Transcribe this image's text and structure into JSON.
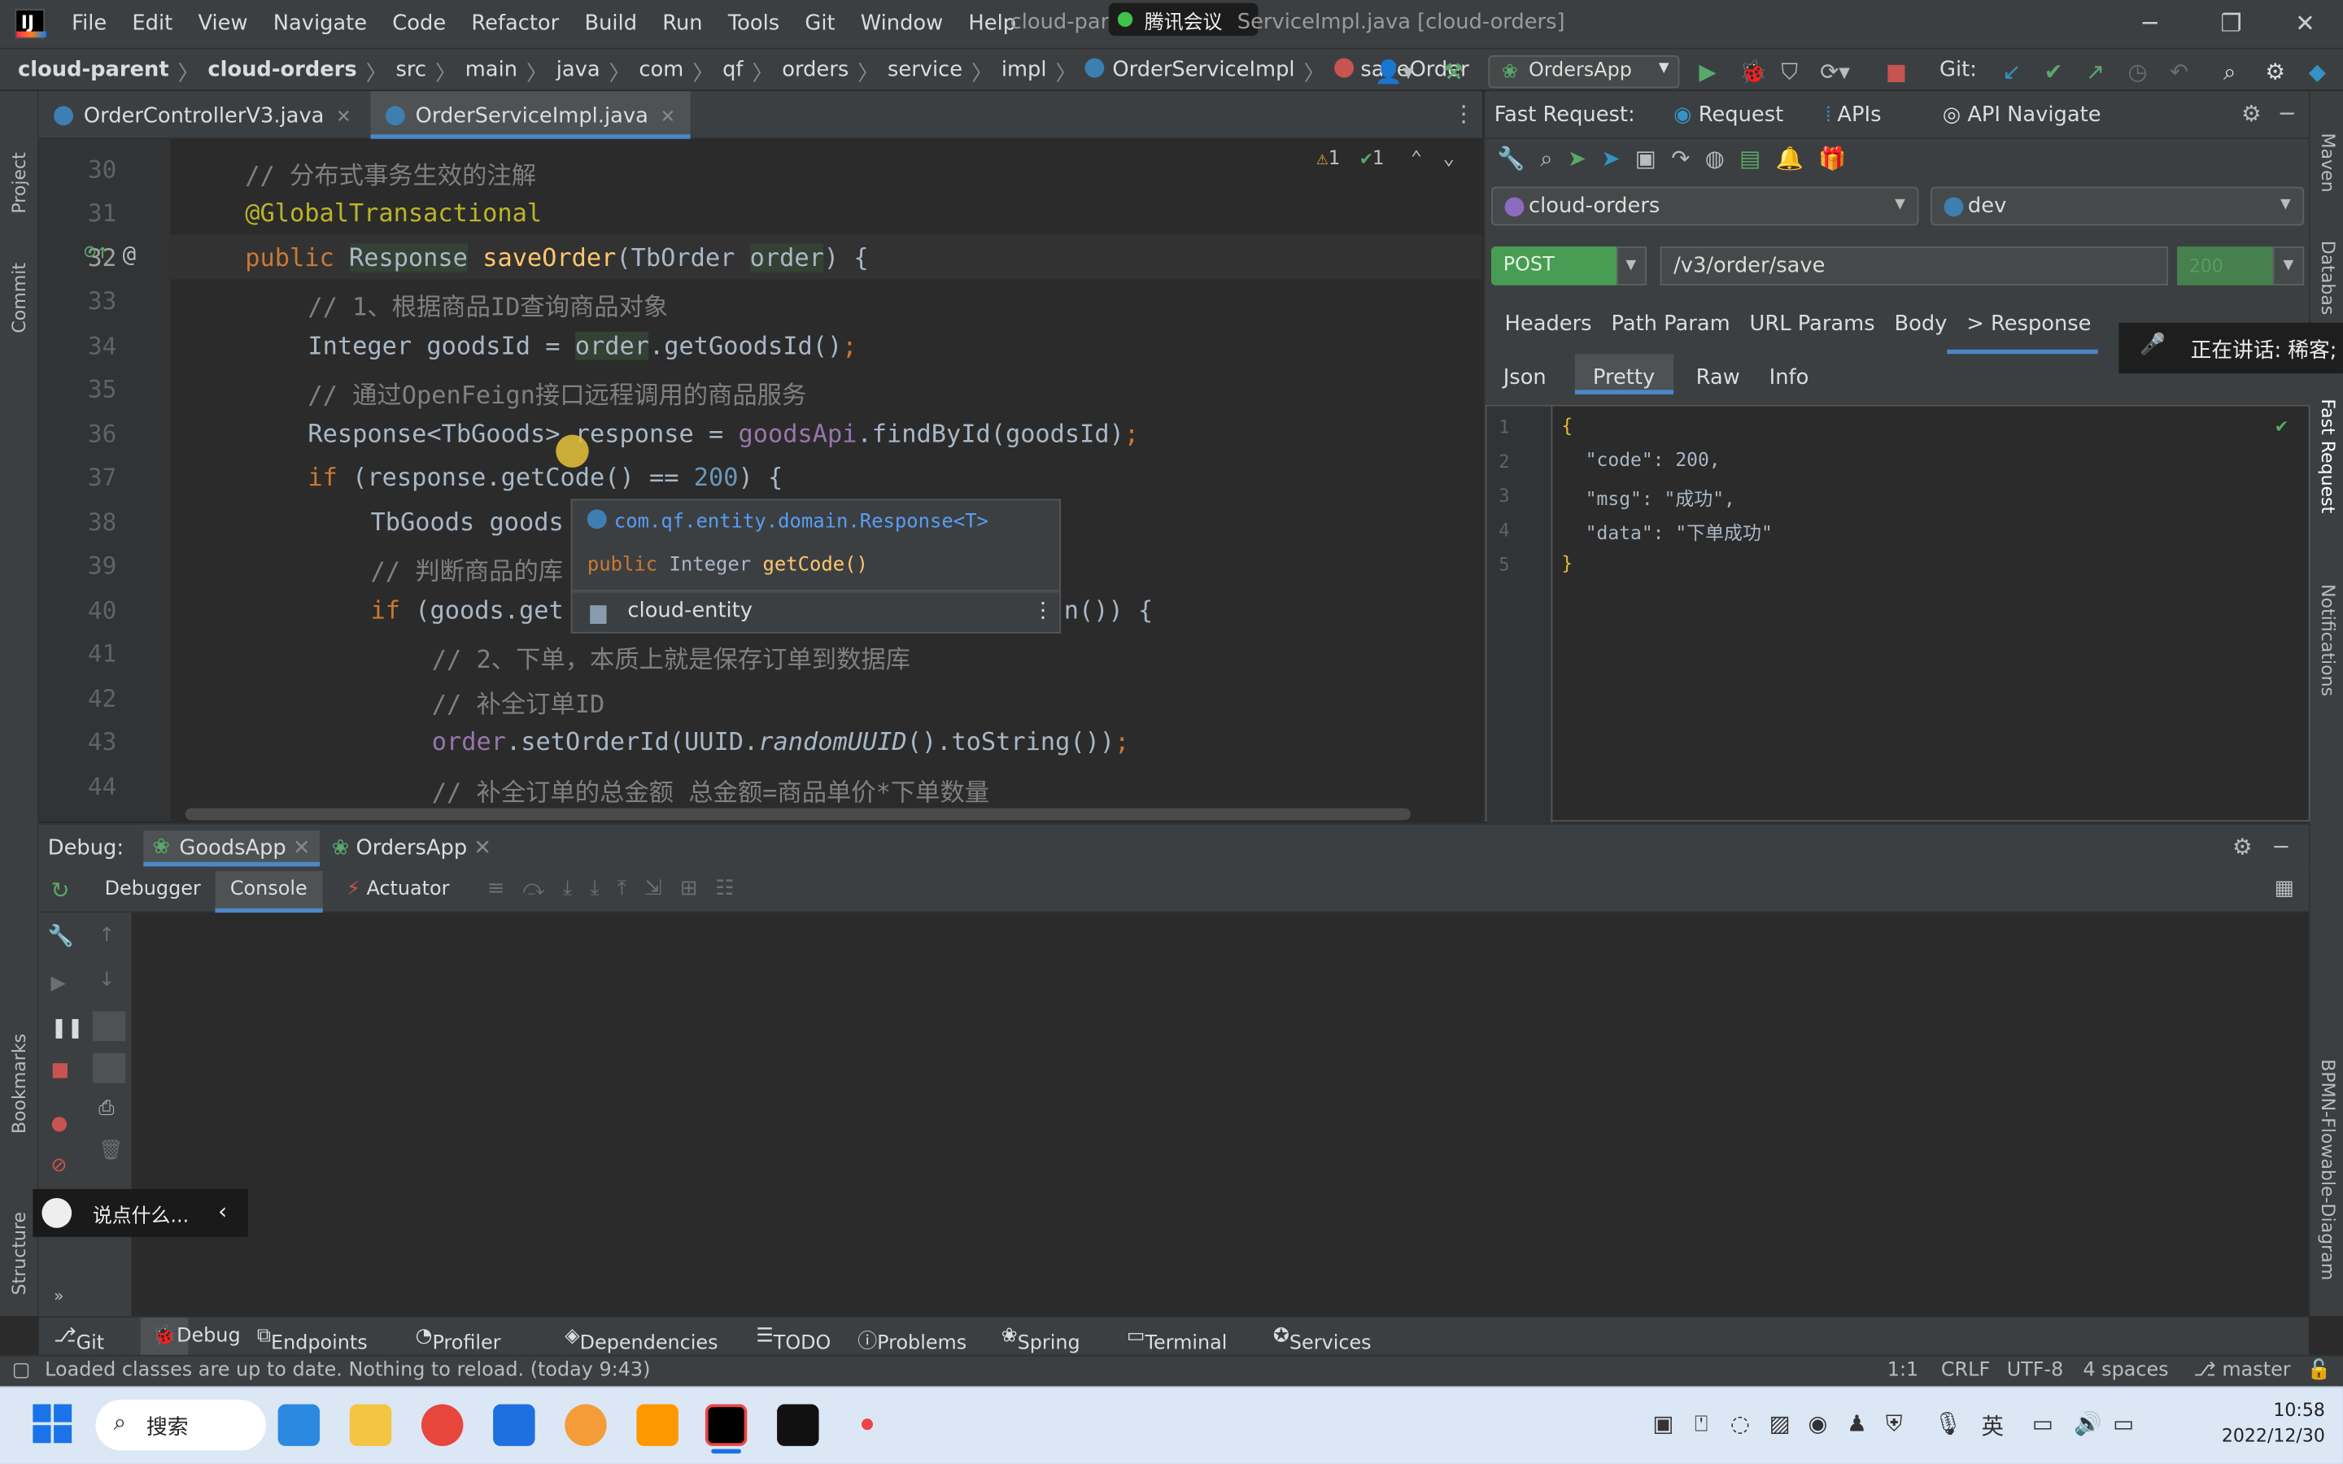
{
  "window": {
    "title": "cloud-parent - OrderServiceImpl.java [cloud-orders]",
    "title_visible": "cloud-par",
    "title_right": "ServiceImpl.java [cloud-orders]",
    "meeting_label": "腾讯会议"
  },
  "menu": [
    "File",
    "Edit",
    "View",
    "Navigate",
    "Code",
    "Refactor",
    "Build",
    "Run",
    "Tools",
    "Git",
    "Window",
    "Help"
  ],
  "breadcrumb": [
    "cloud-parent",
    "cloud-orders",
    "src",
    "main",
    "java",
    "com",
    "qf",
    "orders",
    "service",
    "impl",
    "OrderServiceImpl",
    "saveOrder"
  ],
  "run_config": "OrdersApp",
  "git_label": "Git:",
  "left_strip": [
    "Project",
    "Commit",
    "Bookmarks",
    "Structure"
  ],
  "right_strip": [
    "Maven",
    "Database",
    "Fast Request",
    "Notifications",
    "BPMN-Flowable-Diagram"
  ],
  "editor": {
    "tabs": [
      {
        "label": "OrderControllerV3.java",
        "active": false
      },
      {
        "label": "OrderServiceImpl.java",
        "active": true
      }
    ],
    "inspections": {
      "warnings": "1",
      "ok": "1"
    },
    "lines": [
      {
        "n": "30",
        "text": "// 分布式事务生效的注解"
      },
      {
        "n": "31",
        "text": "@GlobalTransactional"
      },
      {
        "n": "32",
        "text": "public Response saveOrder(TbOrder order) {"
      },
      {
        "n": "33",
        "text": "// 1、根据商品ID查询商品对象"
      },
      {
        "n": "34",
        "text": "Integer goodsId = order.getGoodsId();"
      },
      {
        "n": "35",
        "text": "// 通过OpenFeign接口远程调用的商品服务"
      },
      {
        "n": "36",
        "text": "Response<TbGoods> response = goodsApi.findById(goodsId);"
      },
      {
        "n": "37",
        "text": "if (response.getCode() == 200) {"
      },
      {
        "n": "38",
        "text": "TbGoods goods"
      },
      {
        "n": "39",
        "text": "// 判断商品的库"
      },
      {
        "n": "40",
        "text": "if (goods.get"
      },
      {
        "n": "41",
        "text": "// 2、下单，本质上就是保存订单到数据库"
      },
      {
        "n": "42",
        "text": "// 补全订单ID"
      },
      {
        "n": "43",
        "text": "order.setOrderId(UUID.randomUUID().toString());"
      },
      {
        "n": "44",
        "text": "// 补全订单的总金额 总金额=商品单价*下单数量"
      }
    ],
    "line40_tail": "n()) {",
    "popup": {
      "class": "com.qf.entity.domain.Response<T>",
      "signature": "public Integer getCode()",
      "module": "cloud-entity"
    }
  },
  "fast_request": {
    "title": "Fast Request:",
    "tabs": [
      "Request",
      "APIs",
      "API Navigate"
    ],
    "project": "cloud-orders",
    "env": "dev",
    "method": "POST",
    "url": "/v3/order/save",
    "status": "200",
    "req_tabs": [
      "Headers",
      "Path Param",
      "URL Params",
      "Body",
      "> Response"
    ],
    "resp_tabs": [
      "Json",
      "Pretty",
      "Raw",
      "Info"
    ],
    "response_lines": [
      "{",
      "\"code\": 200,",
      "\"msg\": \"成功\",",
      "\"data\": \"下单成功\"",
      "}"
    ]
  },
  "overlay": {
    "speaking": "正在讲话: 稀客;",
    "chat": "说点什么..."
  },
  "debug": {
    "label": "Debug:",
    "sessions": [
      "GoodsApp",
      "OrdersApp"
    ],
    "tabs": [
      "Debugger",
      "Console",
      "Actuator"
    ]
  },
  "bottom_tools": [
    "Git",
    "Debug",
    "Endpoints",
    "Profiler",
    "Dependencies",
    "TODO",
    "Problems",
    "Spring",
    "Terminal",
    "Services"
  ],
  "status": {
    "message": "Loaded classes are up to date. Nothing to reload. (today 9:43)",
    "position": "1:1",
    "line_sep": "CRLF",
    "encoding": "UTF-8",
    "indent": "4 spaces",
    "branch": "master"
  },
  "taskbar": {
    "search": "搜索",
    "ime": "英",
    "time": "10:58",
    "date": "2022/12/30"
  }
}
